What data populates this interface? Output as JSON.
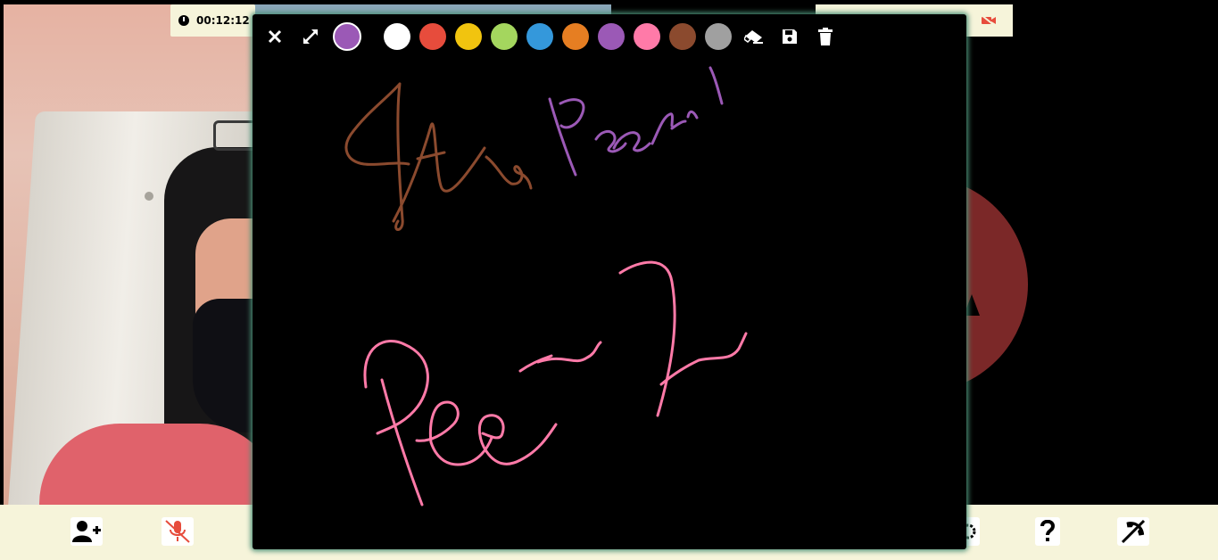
{
  "call": {
    "timer": "00:12:12"
  },
  "colors": {
    "current": "#9b59b6",
    "palette": [
      "#ffffff",
      "#e74c3c",
      "#f1c40f",
      "#a4d65e",
      "#3498db",
      "#e67e22",
      "#9b59b6",
      "#ff7aa8",
      "#8b4a2e",
      "#a0a0a0"
    ]
  },
  "whiteboard": {
    "strokes": [
      {
        "color": "#8b4a2e",
        "label": "brown-writing"
      },
      {
        "color": "#9b59b6",
        "label": "purple-writing"
      },
      {
        "color": "#ff7aa8",
        "label": "pink-writing"
      }
    ]
  },
  "icons": {
    "close": "close-icon",
    "expand": "expand-icon",
    "eraser": "eraser-icon",
    "save": "save-icon",
    "trash": "trash-icon",
    "add_user": "add-user-icon",
    "mic_off": "mic-off-icon",
    "settings": "settings-icon",
    "help": "help-icon",
    "end_call": "end-call-icon",
    "cam_off": "camera-off-icon"
  }
}
